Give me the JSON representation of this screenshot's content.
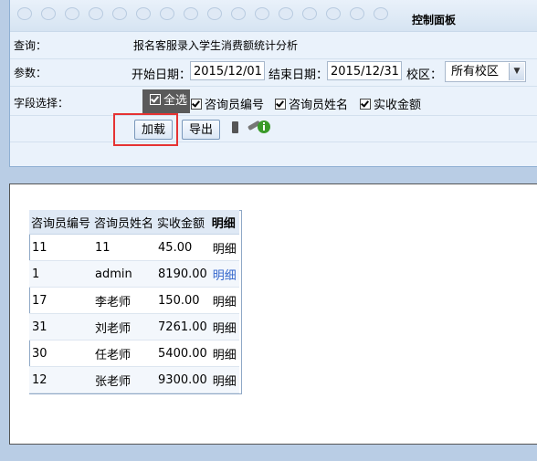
{
  "panel": {
    "title": "控制面板"
  },
  "query": {
    "label": "查询：",
    "value": "报名客服录入学生消费额统计分析"
  },
  "params": {
    "label": "参数：",
    "start_label": "开始日期：",
    "start_value": "2015/12/01",
    "end_label": "结束日期：",
    "end_value": "2015/12/31",
    "campus_label": "校区：",
    "campus_value": "所有校区"
  },
  "fields": {
    "label": "字段选择：",
    "select_all": "全选",
    "options": [
      "咨询员编号",
      "咨询员姓名",
      "实收金额"
    ]
  },
  "actions": {
    "load": "加载",
    "export": "导出"
  },
  "table": {
    "headers": [
      "咨询员编号",
      "咨询员姓名",
      "实收金额",
      "明细"
    ],
    "rows": [
      [
        "11",
        "11",
        "45.00",
        "明细"
      ],
      [
        "1",
        "admin",
        "8190.00",
        "明细"
      ],
      [
        "17",
        "李老师",
        "150.00",
        "明细"
      ],
      [
        "31",
        "刘老师",
        "7261.00",
        "明细"
      ],
      [
        "30",
        "任老师",
        "5400.00",
        "明细"
      ],
      [
        "12",
        "张老师",
        "9300.00",
        "明细"
      ]
    ]
  },
  "colors": {
    "highlight": "#e53333",
    "link": "#3366cc"
  }
}
